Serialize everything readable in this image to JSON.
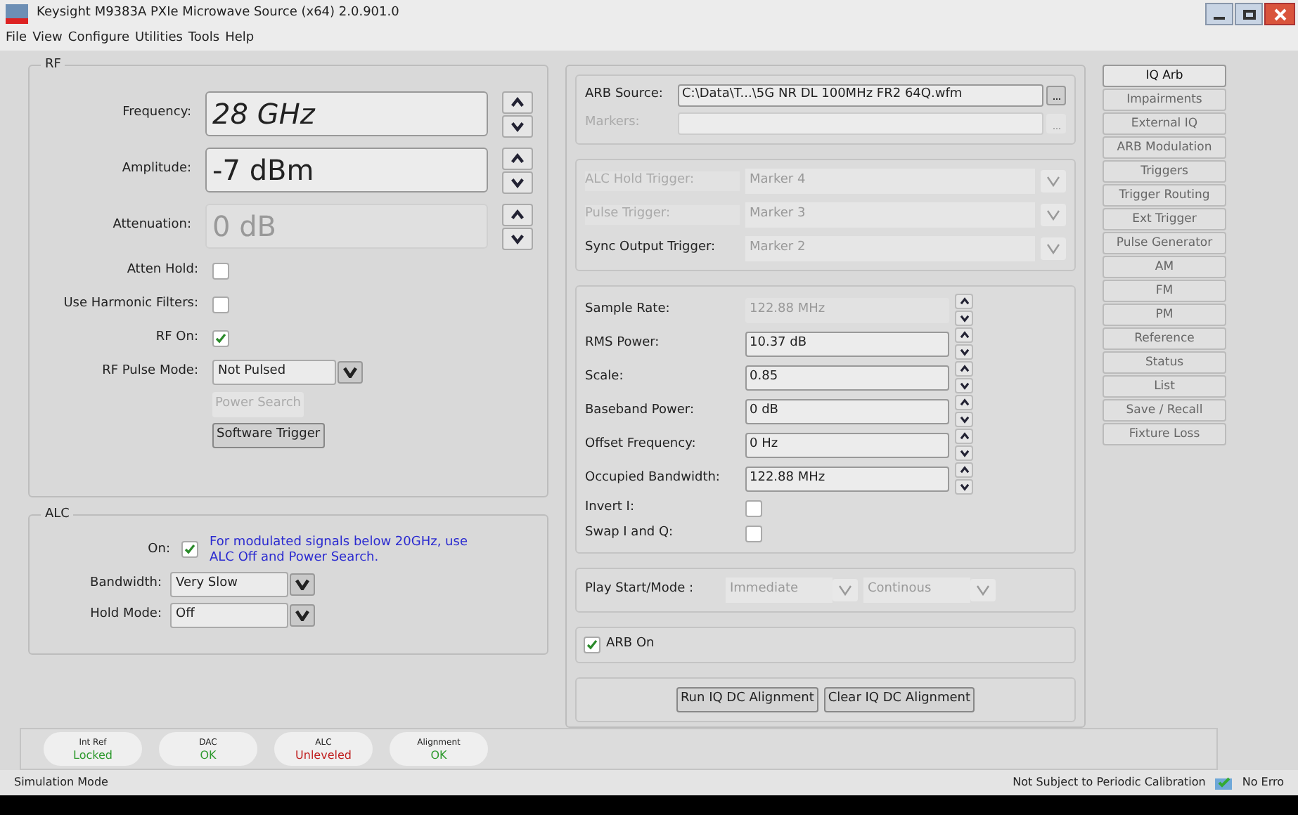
{
  "window": {
    "title": "Keysight M9383A PXIe Microwave Source (x64)  2.0.901.0"
  },
  "menu": [
    "File",
    "View",
    "Configure",
    "Utilities",
    "Tools",
    "Help"
  ],
  "rf": {
    "title": "RF",
    "rows": [
      {
        "kind": "spin",
        "label": "Frequency:",
        "value": "28 GHz",
        "italic": true,
        "disabled": false
      },
      {
        "kind": "spin",
        "label": "Amplitude:",
        "value": "-7 dBm",
        "italic": false,
        "disabled": false
      },
      {
        "kind": "spin",
        "label": "Attenuation:",
        "value": "0 dB",
        "italic": false,
        "disabled": true
      },
      {
        "kind": "check",
        "label": "Atten Hold:",
        "checked": false
      },
      {
        "kind": "check",
        "label": "Use Harmonic Filters:",
        "checked": false
      },
      {
        "kind": "check",
        "label": "RF On:",
        "checked": true
      },
      {
        "kind": "select",
        "label": "RF Pulse Mode:",
        "value": "Not Pulsed"
      },
      {
        "kind": "button",
        "label": "Power Search",
        "disabled": true
      },
      {
        "kind": "button",
        "label": "Software Trigger",
        "disabled": false
      }
    ]
  },
  "alc": {
    "title": "ALC",
    "on": {
      "label": "On:",
      "checked": true,
      "note": "For modulated signals below 20GHz, use ALC Off and Power Search."
    },
    "selects": [
      {
        "label": "Bandwidth:",
        "value": "Very Slow"
      },
      {
        "label": "Hold Mode:",
        "value": "Off"
      }
    ]
  },
  "arb": {
    "source": {
      "label": "ARB Source:",
      "value": "C:\\Data\\T...\\5G NR DL 100MHz FR2 64Q.wfm",
      "disabled": false
    },
    "markers": {
      "label": "Markers:",
      "disabled": true
    }
  },
  "triggers": [
    {
      "label": "ALC Hold Trigger:",
      "value": "Marker 4",
      "disabled": true
    },
    {
      "label": "Pulse Trigger:",
      "value": "Marker 3",
      "disabled": true
    },
    {
      "label": "Sync Output Trigger:",
      "value": "Marker 2",
      "disabled": false
    }
  ],
  "params": [
    {
      "kind": "spin",
      "label": "Sample Rate:",
      "value": "122.88 MHz",
      "disabled": true
    },
    {
      "kind": "spin",
      "label": "RMS Power:",
      "value": "10.37 dB",
      "disabled": false
    },
    {
      "kind": "spin",
      "label": "Scale:",
      "value": "0.85",
      "disabled": false
    },
    {
      "kind": "spin",
      "label": "Baseband Power:",
      "value": "0 dB",
      "disabled": false
    },
    {
      "kind": "spin",
      "label": "Offset Frequency:",
      "value": "0 Hz",
      "disabled": false
    },
    {
      "kind": "spin",
      "label": "Occupied Bandwidth:",
      "value": "122.88 MHz",
      "disabled": false
    },
    {
      "kind": "check",
      "label": "Invert I:",
      "checked": false
    },
    {
      "kind": "check",
      "label": "Swap I and Q:",
      "checked": false
    }
  ],
  "play": {
    "label": "Play Start/Mode :",
    "options": [
      "Immediate",
      "Continous"
    ]
  },
  "arb_on": {
    "label": "ARB On",
    "checked": true
  },
  "alignment_buttons": [
    "Run IQ DC Alignment",
    "Clear IQ DC Alignment"
  ],
  "tabs": [
    {
      "label": "IQ Arb",
      "selected": true
    },
    {
      "label": "Impairments",
      "selected": false
    },
    {
      "label": "External IQ",
      "selected": false
    },
    {
      "label": "ARB Modulation",
      "selected": false
    },
    {
      "label": "Triggers",
      "selected": false
    },
    {
      "label": "Trigger Routing",
      "selected": false
    },
    {
      "label": "Ext Trigger",
      "selected": false
    },
    {
      "label": "Pulse Generator",
      "selected": false
    },
    {
      "label": "AM",
      "selected": false
    },
    {
      "label": "FM",
      "selected": false
    },
    {
      "label": "PM",
      "selected": false
    },
    {
      "label": "Reference",
      "selected": false
    },
    {
      "label": "Status",
      "selected": false
    },
    {
      "label": "List",
      "selected": false
    },
    {
      "label": "Save / Recall",
      "selected": false
    },
    {
      "label": "Fixture Loss",
      "selected": false
    }
  ],
  "indicators": [
    {
      "label": "Int Ref",
      "value": "Locked",
      "color": "#2e9a2e"
    },
    {
      "label": "DAC",
      "value": "OK",
      "color": "#2e9a2e"
    },
    {
      "label": "ALC",
      "value": "Unleveled",
      "color": "#c02020"
    },
    {
      "label": "Alignment",
      "value": "OK",
      "color": "#2e9a2e"
    }
  ],
  "status_bar": {
    "mode": "Simulation Mode",
    "calibration": "Not Subject to Periodic Calibration",
    "errors": "No Erro"
  }
}
